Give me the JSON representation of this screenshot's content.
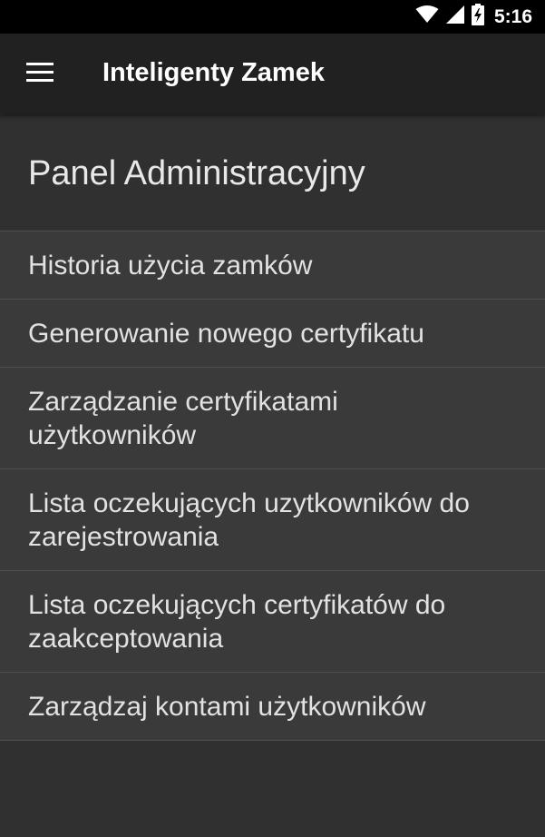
{
  "status_bar": {
    "time": "5:16",
    "icons": [
      "wifi-icon",
      "signal-icon",
      "battery-charging-icon"
    ]
  },
  "app_bar": {
    "title": "Inteligenty Zamek",
    "menu_icon": "hamburger-menu-icon"
  },
  "panel": {
    "title": "Panel Administracyjny"
  },
  "menu_items": [
    {
      "label": "Historia użycia zamków"
    },
    {
      "label": "Generowanie nowego certyfikatu"
    },
    {
      "label": "Zarządzanie certyfikatami użytkowników"
    },
    {
      "label": "Lista oczekujących uzytkowników do zarejestrowania"
    },
    {
      "label": "Lista oczekujących certyfikatów do zaakceptowania"
    },
    {
      "label": "Zarządzaj kontami użytkowników"
    }
  ],
  "colors": {
    "background": "#303030",
    "app_bar": "#212121",
    "list_background": "#3a3a3a",
    "divider": "#505050",
    "text": "#e2e2e2"
  }
}
